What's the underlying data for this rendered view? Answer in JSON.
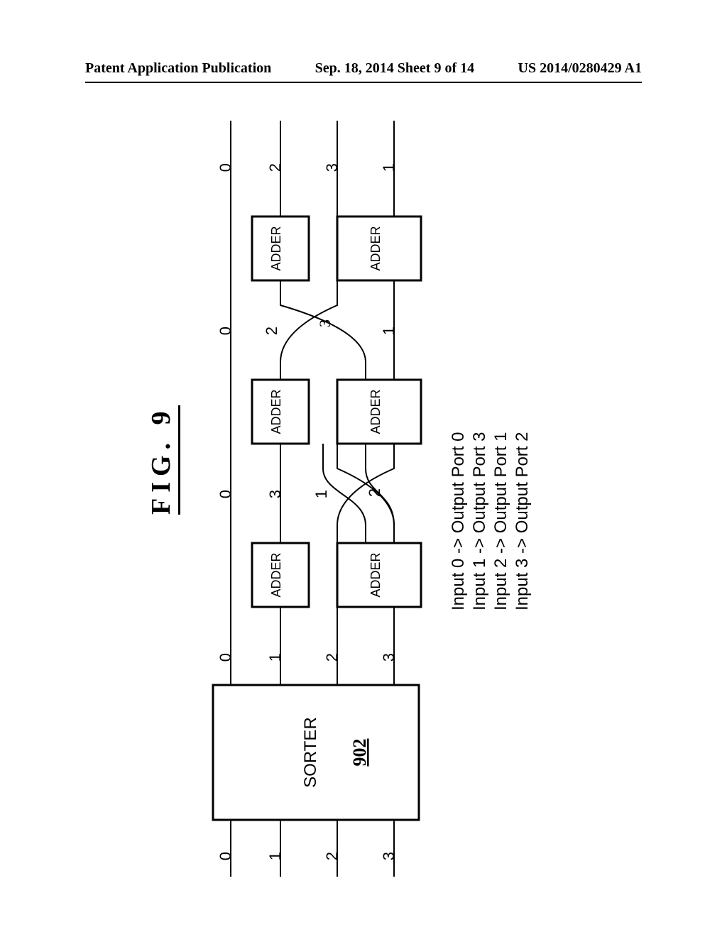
{
  "header": {
    "left": "Patent Application Publication",
    "center": "Sep. 18, 2014 Sheet 9 of 14",
    "right": "US 2014/0280429 A1"
  },
  "figure": {
    "label": "FIG. 9",
    "sorter": {
      "label": "SORTER",
      "ref": "902"
    },
    "adder_label": "ADDER",
    "inputs": [
      "0",
      "1",
      "2",
      "3"
    ],
    "after_sorter": [
      "0",
      "1",
      "2",
      "3"
    ],
    "after_stage1": [
      "0",
      "3",
      "1",
      "2"
    ],
    "after_stage2": [
      "0",
      "2",
      "3",
      "1"
    ],
    "outputs": [
      "0",
      "2",
      "3",
      "1"
    ],
    "mapping": [
      "Input 0 -> Output Port 0",
      "Input 1 -> Output Port 3",
      "Input 2 -> Output Port 1",
      "Input 3 -> Output Port 2"
    ]
  }
}
